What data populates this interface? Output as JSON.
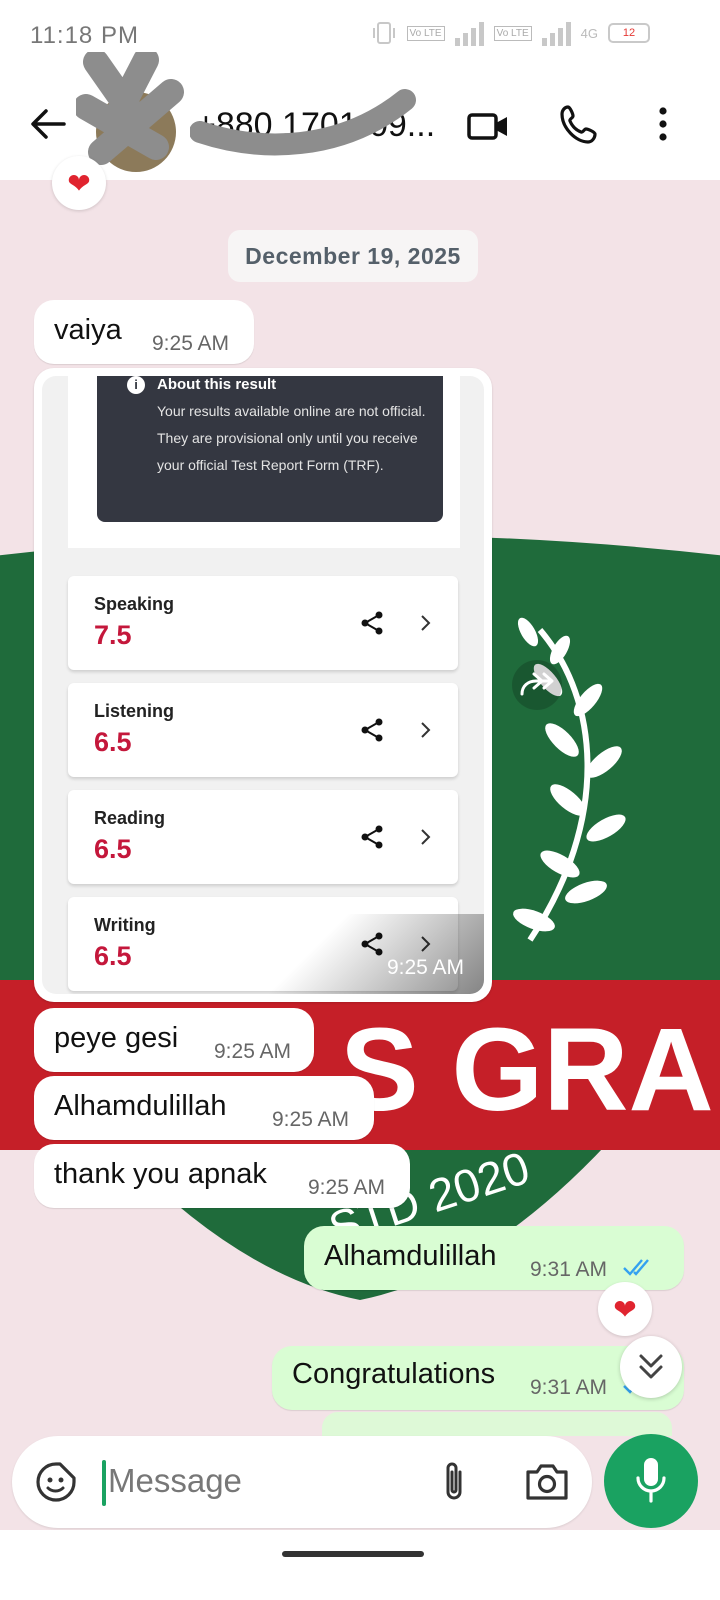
{
  "status_bar": {
    "time": "11:18 PM",
    "network_1": "Vo LTE",
    "network_2": "Vo LTE",
    "network_3": "4G",
    "battery": "12"
  },
  "header": {
    "contact_name": "+880 1701-09...",
    "back_icon": "arrow-left",
    "video_icon": "video-camera",
    "call_icon": "phone",
    "menu_icon": "more-vertical"
  },
  "chat": {
    "reaction_emoji": "❤",
    "date": "December 19, 2025",
    "messages": [
      {
        "text": "vaiya",
        "time": "9:25 AM",
        "direction": "in"
      },
      {
        "text": "peye gesi",
        "time": "9:25 AM",
        "direction": "in"
      },
      {
        "text": "Alhamdulillah",
        "time": "9:25 AM",
        "direction": "in"
      },
      {
        "text": "thank you apnak",
        "time": "9:25 AM",
        "direction": "in"
      },
      {
        "text": "Alhamdulillah",
        "time": "9:31 AM",
        "direction": "out",
        "status": "read"
      },
      {
        "text": "Congratulations",
        "time": "9:31 AM",
        "direction": "out",
        "status": "read"
      }
    ],
    "image_message": {
      "time": "9:25 AM",
      "info_title": "About this result",
      "info_body": "Your results available online are not official. They are provisional only until you receive your official Test Report Form (TRF).",
      "scores": [
        {
          "label": "Speaking",
          "value": "7.5"
        },
        {
          "label": "Listening",
          "value": "6.5"
        },
        {
          "label": "Reading",
          "value": "6.5"
        },
        {
          "label": "Writing",
          "value": "6.5"
        }
      ],
      "score_color": "#c4173b"
    },
    "wallpaper_text": "S GRAM",
    "wallpaper_subtext": "STD 2020"
  },
  "input_bar": {
    "placeholder": "Message",
    "emoji_icon": "sticker-smile",
    "attach_icon": "paperclip",
    "camera_icon": "camera",
    "mic_icon": "microphone"
  },
  "colors": {
    "accent": "#1aa261",
    "outgoing_bubble": "#d9fdd3",
    "read_ticks": "#34a1f0",
    "wallpaper_green": "#1f6b3b",
    "wallpaper_red": "#c51f28"
  }
}
